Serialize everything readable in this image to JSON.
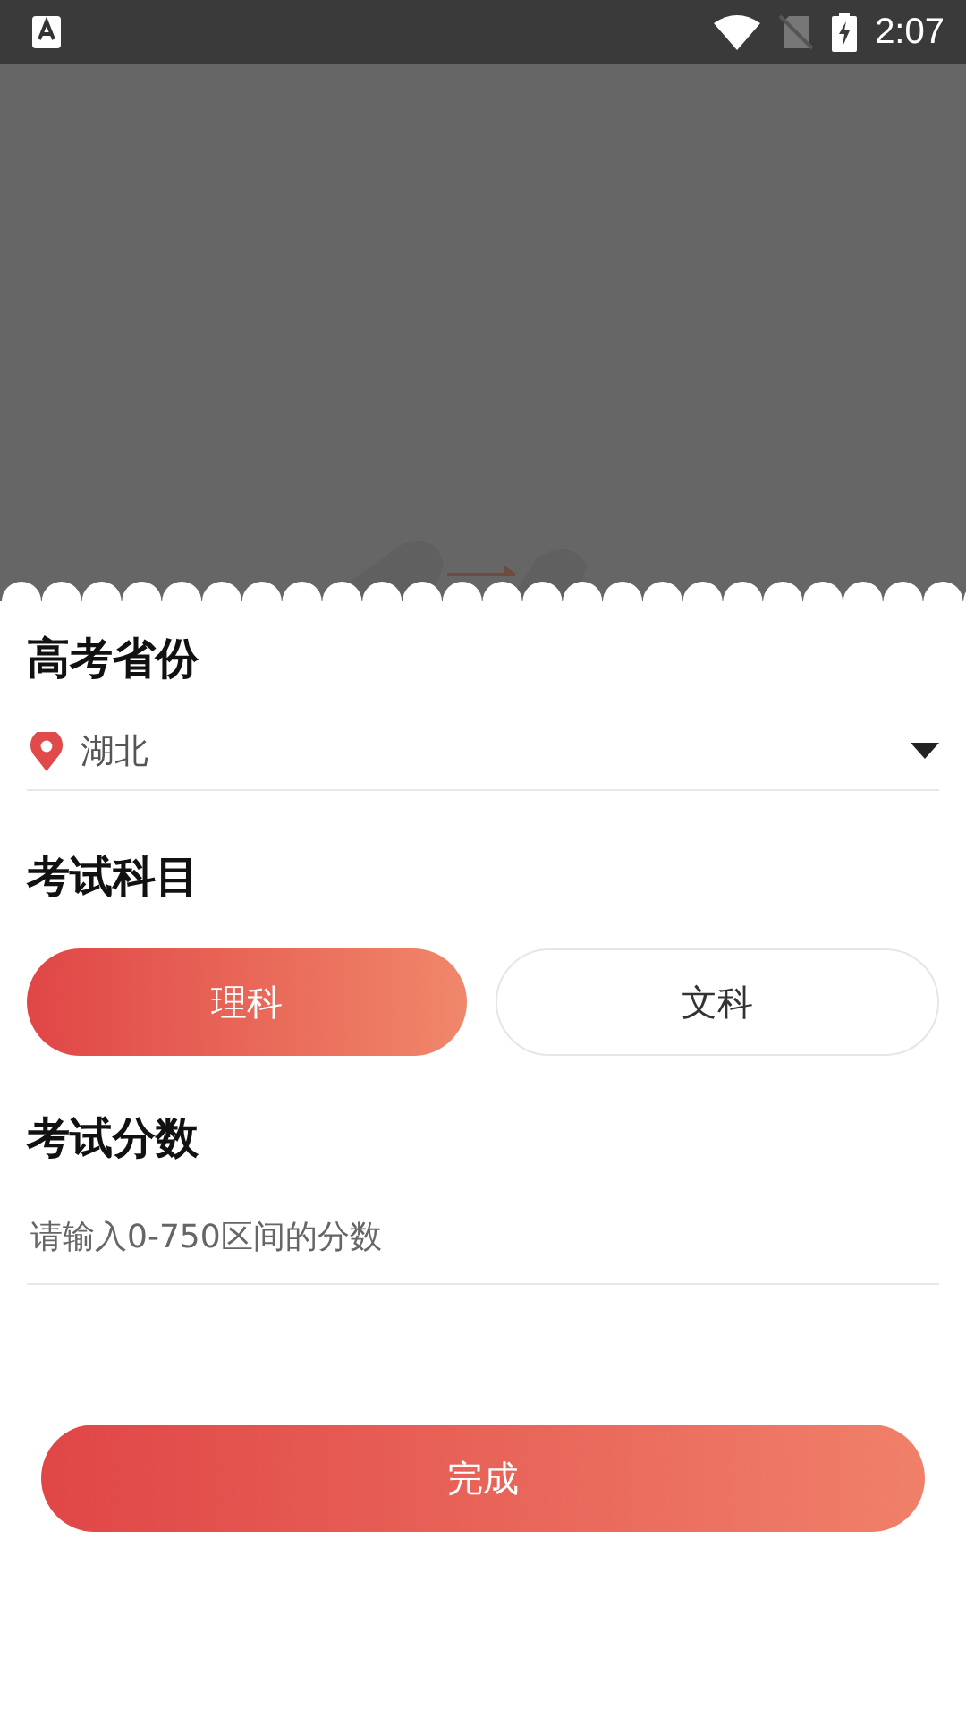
{
  "status_bar": {
    "time": "2:07"
  },
  "province": {
    "title": "高考省份",
    "value": "湖北"
  },
  "subject": {
    "title": "考试科目",
    "options": [
      {
        "label": "理科",
        "selected": true
      },
      {
        "label": "文科",
        "selected": false
      }
    ]
  },
  "score": {
    "title": "考试分数",
    "placeholder": "请输入0-750区间的分数"
  },
  "submit": {
    "label": "完成"
  }
}
